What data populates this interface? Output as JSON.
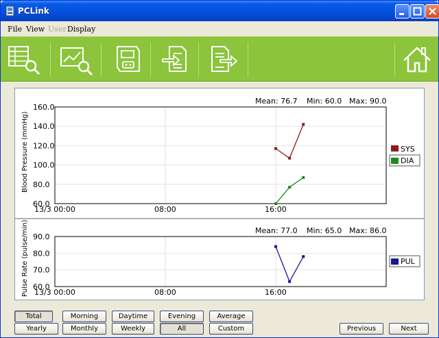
{
  "window": {
    "title": "PCLink"
  },
  "menu": [
    {
      "label": "File",
      "disabled": false
    },
    {
      "label": "View",
      "disabled": false
    },
    {
      "label": "User",
      "disabled": true
    },
    {
      "label": "Display",
      "disabled": false
    }
  ],
  "toolbar": {
    "buttons": [
      "table-search-icon",
      "chart-search-icon",
      "device-icon",
      "document-import-icon",
      "document-export-icon"
    ],
    "home": "home-icon"
  },
  "colors": {
    "toolbar": "#8cc43c",
    "sys": "#8b1a1a",
    "dia": "#1a8b1a",
    "pul": "#1a1a8b"
  },
  "bp_chart": {
    "stats": {
      "mean": "Mean: 76.7",
      "min": "Min: 60.0",
      "max": "Max: 90.0"
    },
    "ylabel": "Blood Pressure (mmHg)",
    "y_ticks": [
      "160.0",
      "140.0",
      "120.0",
      "100.0",
      "80.0",
      "60.0"
    ],
    "x_ticks": [
      "13/3 00:00",
      "08:00",
      "16:00"
    ],
    "legend": [
      "SYS",
      "DIA"
    ]
  },
  "pul_chart": {
    "stats": {
      "mean": "Mean: 77.0",
      "min": "Min: 65.0",
      "max": "Max: 86.0"
    },
    "ylabel": "Pulse Rate (pulse/min)",
    "y_ticks": [
      "90.0",
      "80.0",
      "70.0",
      "60.0"
    ],
    "x_ticks": [
      "13/3 00:00",
      "08:00",
      "16:00"
    ],
    "legend": [
      "PUL"
    ]
  },
  "chart_data": [
    {
      "type": "line",
      "ylabel": "Blood Pressure (mmHg)",
      "ylim": [
        60,
        160
      ],
      "x_range_hours": [
        0,
        24
      ],
      "x_tick_labels": [
        "13/3 00:00",
        "08:00",
        "16:00"
      ],
      "series": [
        {
          "name": "SYS",
          "x_hours": [
            16.0,
            17.0,
            18.0
          ],
          "values": [
            117,
            107,
            142
          ]
        },
        {
          "name": "DIA",
          "x_hours": [
            16.0,
            17.0,
            18.0
          ],
          "values": [
            60,
            77,
            87
          ]
        }
      ]
    },
    {
      "type": "line",
      "ylabel": "Pulse Rate (pulse/min)",
      "ylim": [
        60,
        90
      ],
      "x_range_hours": [
        0,
        24
      ],
      "x_tick_labels": [
        "13/3 00:00",
        "08:00",
        "16:00"
      ],
      "series": [
        {
          "name": "PUL",
          "x_hours": [
            16.0,
            17.0,
            18.0
          ],
          "values": [
            84,
            63,
            78
          ]
        }
      ]
    }
  ],
  "buttons_row1": [
    "Total",
    "Morning",
    "Daytime",
    "Evening",
    "Average"
  ],
  "buttons_row2": [
    "Yearly",
    "Monthly",
    "Weekly",
    "All",
    "Custom"
  ],
  "nav": {
    "previous": "Previous",
    "next": "Next"
  }
}
